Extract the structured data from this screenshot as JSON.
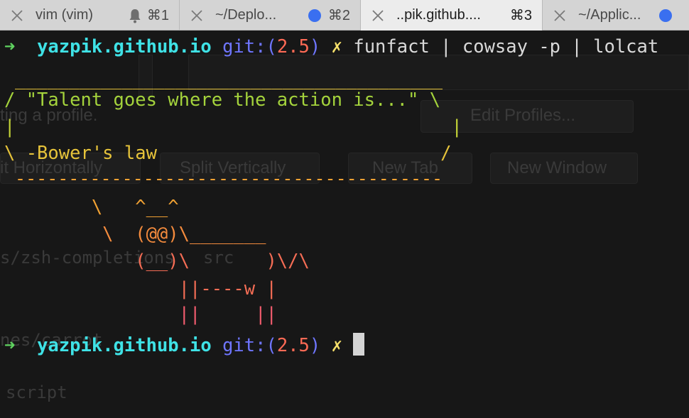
{
  "tabs": [
    {
      "title": "vim (vim)",
      "indicator": "bell-icon",
      "shortcut": "⌘1",
      "active": false
    },
    {
      "title": "~/Deplo...",
      "indicator": "blue-dot",
      "shortcut": "⌘2",
      "active": false
    },
    {
      "title": "..pik.github....",
      "indicator": "",
      "shortcut": "⌘3",
      "active": true
    },
    {
      "title": "~/Applic...",
      "indicator": "blue-dot",
      "shortcut": "",
      "active": false
    }
  ],
  "prompt": {
    "arrow": "➜",
    "host": "yazpik.github.io",
    "git_label": "git:(",
    "branch": "2.5",
    "git_close": ")",
    "dirty": "✗"
  },
  "command": "funfact | cowsay -p | lolcat",
  "cowsay": {
    "top": " ________________________________________",
    "line1": "/ \"Talent goes where the action is...\" \\",
    "line2": "|                                        |",
    "line3": "\\ -Bower's law                          /",
    "bottom": " ----------------------------------------",
    "cow1": "        \\   ^__^",
    "cow2": "         \\  (@@)\\_______",
    "cow3": "            (__)\\       )\\/\\",
    "cow4": "                ||----w |",
    "cow5": "                ||     ||"
  },
  "background_ghost": {
    "profile_text": "ting a profile.",
    "edit_profiles": "Edit Profiles...",
    "split_horizontally": "it Horizontally",
    "split_vertically": "Split Vertically",
    "new_tab": "New Tab",
    "new_window": "New Window",
    "path1": "s/zsh-completions",
    "src": "src",
    "path2": "nes/carrot",
    "script": "script"
  },
  "colors": {
    "host": "#3fe2e6",
    "git": "#6f76ff",
    "branch": "#ff6a55",
    "dirty": "#f6e06a",
    "arrow": "#5fd35f",
    "tab_dot": "#3a6ff0"
  }
}
